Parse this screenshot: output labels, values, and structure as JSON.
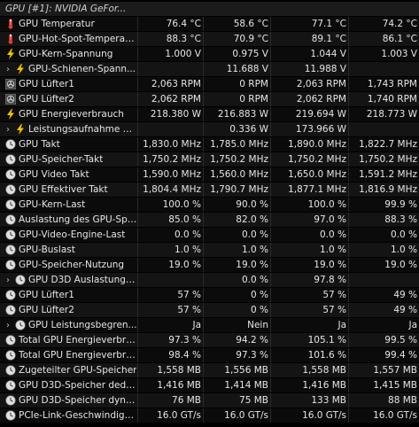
{
  "header": {
    "title": "GPU [#1]: NVIDIA GeFor..."
  },
  "rows": [
    {
      "icon": "thermometer-icon",
      "label": "GPU Temperatur",
      "v": [
        "76.4 °C",
        "58.6 °C",
        "77.1 °C",
        "74.2 °C"
      ]
    },
    {
      "icon": "thermometer-icon",
      "label": "GPU-Hot-Spot-Temperatur",
      "v": [
        "88.3 °C",
        "70.9 °C",
        "89.1 °C",
        "86.1 °C"
      ]
    },
    {
      "icon": "lightning-icon",
      "label": "GPU-Kern-Spannung",
      "v": [
        "1.000 V",
        "0.975 V",
        "1.044 V",
        "1.003 V"
      ]
    },
    {
      "icon": "lightning-icon",
      "label": "GPU-Schienen-Spann...",
      "v": [
        "",
        "11.688 V",
        "11.988 V",
        ""
      ],
      "expandable": true
    },
    {
      "icon": "fan-icon",
      "label": "GPU Lüfter1",
      "v": [
        "2,063 RPM",
        "0 RPM",
        "2,063 RPM",
        "1,743 RPM"
      ]
    },
    {
      "icon": "fan-icon",
      "label": "GPU Lüfter2",
      "v": [
        "2,062 RPM",
        "0 RPM",
        "2,062 RPM",
        "1,740 RPM"
      ]
    },
    {
      "icon": "lightning-icon",
      "label": "GPU Energieverbrauch",
      "v": [
        "218.380 W",
        "216.883 W",
        "219.694 W",
        "218.773 W"
      ]
    },
    {
      "icon": "lightning-icon",
      "label": "Leistungsaufnahme d...",
      "v": [
        "",
        "0.336 W",
        "173.966 W",
        ""
      ],
      "expandable": true
    },
    {
      "icon": "clock-icon",
      "label": "GPU Takt",
      "v": [
        "1,830.0 MHz",
        "1,785.0 MHz",
        "1,890.0 MHz",
        "1,822.7 MHz"
      ]
    },
    {
      "icon": "clock-icon",
      "label": "GPU-Speicher-Takt",
      "v": [
        "1,750.2 MHz",
        "1,750.2 MHz",
        "1,750.2 MHz",
        "1,750.2 MHz"
      ]
    },
    {
      "icon": "clock-icon",
      "label": "GPU Video Takt",
      "v": [
        "1,590.0 MHz",
        "1,560.0 MHz",
        "1,650.0 MHz",
        "1,591.2 MHz"
      ]
    },
    {
      "icon": "clock-icon",
      "label": "GPU Effektiver Takt",
      "v": [
        "1,804.4 MHz",
        "1,790.7 MHz",
        "1,877.1 MHz",
        "1,816.9 MHz"
      ]
    },
    {
      "icon": "clock-icon",
      "label": "GPU-Kern-Last",
      "v": [
        "100.0 %",
        "90.0 %",
        "100.0 %",
        "99.9 %"
      ]
    },
    {
      "icon": "clock-icon",
      "label": "Auslastung des GPU-Spe...",
      "v": [
        "85.0 %",
        "82.0 %",
        "97.0 %",
        "88.3 %"
      ]
    },
    {
      "icon": "clock-icon",
      "label": "GPU-Video-Engine-Last",
      "v": [
        "0.0 %",
        "0.0 %",
        "0.0 %",
        "0.0 %"
      ]
    },
    {
      "icon": "clock-icon",
      "label": "GPU-Buslast",
      "v": [
        "1.0 %",
        "1.0 %",
        "1.0 %",
        "1.0 %"
      ]
    },
    {
      "icon": "clock-icon",
      "label": "GPU-Speicher-Nutzung",
      "v": [
        "19.0 %",
        "19.0 %",
        "19.0 %",
        "19.0 %"
      ]
    },
    {
      "icon": "clock-icon",
      "label": "GPU D3D Auslastungen",
      "v": [
        "",
        "0.0 %",
        "97.8 %",
        ""
      ],
      "expandable": true
    },
    {
      "icon": "clock-icon",
      "label": "GPU Lüfter1",
      "v": [
        "57 %",
        "0 %",
        "57 %",
        "49 %"
      ]
    },
    {
      "icon": "clock-icon",
      "label": "GPU Lüfter2",
      "v": [
        "57 %",
        "0 %",
        "57 %",
        "49 %"
      ]
    },
    {
      "icon": "clock-icon",
      "label": "GPU Leistungsbegren...",
      "v": [
        "Ja",
        "Nein",
        "Ja",
        "Ja"
      ],
      "expandable": true
    },
    {
      "icon": "clock-icon",
      "label": "Total GPU Energieverbra...",
      "v": [
        "97.3 %",
        "94.2 %",
        "105.1 %",
        "99.5 %"
      ]
    },
    {
      "icon": "clock-icon",
      "label": "Total GPU Energieverbra...",
      "v": [
        "98.4 %",
        "97.3 %",
        "101.6 %",
        "99.4 %"
      ]
    },
    {
      "icon": "clock-icon",
      "label": "Zugeteilter GPU-Speicher",
      "v": [
        "1,558 MB",
        "1,556 MB",
        "1,558 MB",
        "1,557 MB"
      ]
    },
    {
      "icon": "clock-icon",
      "label": "GPU D3D-Speicher dedizi...",
      "v": [
        "1,416 MB",
        "1,414 MB",
        "1,416 MB",
        "1,415 MB"
      ]
    },
    {
      "icon": "clock-icon",
      "label": "GPU D3D-Speicher dyna...",
      "v": [
        "76 MB",
        "75 MB",
        "133 MB",
        "88 MB"
      ]
    },
    {
      "icon": "clock-icon",
      "label": "PCIe-Link-Geschwindigkeit",
      "v": [
        "16.0 GT/s",
        "16.0 GT/s",
        "16.0 GT/s",
        "16.0 GT/s"
      ]
    }
  ],
  "colors": {
    "thermometer": "#e23b2e",
    "lightning": "#f5c400",
    "fan_bg": "#555555",
    "clock": "#d8d8d8"
  }
}
